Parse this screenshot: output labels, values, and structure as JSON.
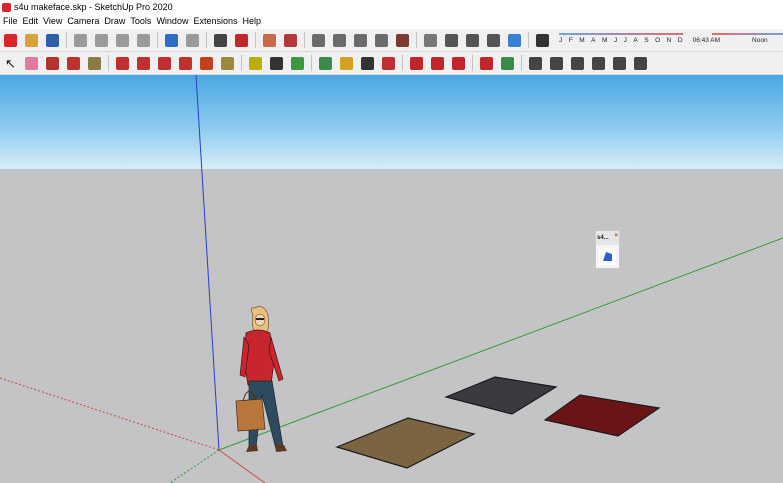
{
  "window": {
    "title": "s4u makeface.skp - SketchUp Pro 2020"
  },
  "menu": [
    {
      "label": "File"
    },
    {
      "label": "Edit"
    },
    {
      "label": "View"
    },
    {
      "label": "Camera"
    },
    {
      "label": "Draw"
    },
    {
      "label": "Tools"
    },
    {
      "label": "Window"
    },
    {
      "label": "Extensions"
    },
    {
      "label": "Help"
    }
  ],
  "shadow_settings": {
    "months": [
      "J",
      "F",
      "M",
      "A",
      "M",
      "J",
      "J",
      "A",
      "S",
      "O",
      "N",
      "D"
    ],
    "time": "06:43 AM",
    "noon": "Noon"
  },
  "toolbar_top": [
    {
      "name": "get-models-icon",
      "color": "#d9262a"
    },
    {
      "name": "open-icon",
      "color": "#d6a23a"
    },
    {
      "name": "save-icon",
      "color": "#2f5fa6"
    },
    {
      "name": "sep"
    },
    {
      "name": "cut-icon",
      "color": "#9a9a9a"
    },
    {
      "name": "copy-icon",
      "color": "#9a9a9a"
    },
    {
      "name": "paste-icon",
      "color": "#9a9a9a"
    },
    {
      "name": "erase-icon",
      "color": "#9a9a9a"
    },
    {
      "name": "sep"
    },
    {
      "name": "undo-icon",
      "color": "#2f6cc4"
    },
    {
      "name": "redo-icon",
      "color": "#9a9a9a"
    },
    {
      "name": "sep"
    },
    {
      "name": "print-icon",
      "color": "#444444"
    },
    {
      "name": "model-info-icon",
      "color": "#c0262a"
    },
    {
      "name": "sep"
    },
    {
      "name": "extension-warehouse-icon",
      "color": "#c86a4a"
    },
    {
      "name": "extension-manager-icon",
      "color": "#b33a3a"
    },
    {
      "name": "sep"
    },
    {
      "name": "style-1-icon",
      "color": "#6b6b6b"
    },
    {
      "name": "style-2-icon",
      "color": "#6b6b6b"
    },
    {
      "name": "style-3-icon",
      "color": "#6b6b6b"
    },
    {
      "name": "style-4-icon",
      "color": "#6b6b6b"
    },
    {
      "name": "style-5-icon",
      "color": "#7a3b30"
    },
    {
      "name": "sep"
    },
    {
      "name": "geo-location-icon",
      "color": "#777777"
    },
    {
      "name": "add-location-icon",
      "color": "#555555"
    },
    {
      "name": "cloud-upload-icon",
      "color": "#555555"
    },
    {
      "name": "share-icon",
      "color": "#555555"
    },
    {
      "name": "trimble-connect-icon",
      "color": "#3a7fd0"
    },
    {
      "name": "sep"
    },
    {
      "name": "shadows-toggle-icon",
      "color": "#333333"
    }
  ],
  "toolbar_bottom": [
    {
      "name": "select-icon",
      "color": "#111111"
    },
    {
      "name": "eraser-icon",
      "color": "#e07aa0"
    },
    {
      "name": "pencil-line-icon",
      "color": "#b3342c"
    },
    {
      "name": "arc-icon",
      "color": "#c03030"
    },
    {
      "name": "rectangle-icon",
      "color": "#8a7a4a"
    },
    {
      "name": "sep"
    },
    {
      "name": "push-pull-icon",
      "color": "#c03030"
    },
    {
      "name": "follow-me-icon",
      "color": "#c03030"
    },
    {
      "name": "move-icon",
      "color": "#c03030"
    },
    {
      "name": "rotate-icon",
      "color": "#c03030"
    },
    {
      "name": "scale-icon",
      "color": "#c04020"
    },
    {
      "name": "offset-icon",
      "color": "#9a8a3a"
    },
    {
      "name": "sep"
    },
    {
      "name": "tape-measure-icon",
      "color": "#b8b000"
    },
    {
      "name": "text-icon",
      "color": "#333333"
    },
    {
      "name": "paint-bucket-icon",
      "color": "#3a9a3a"
    },
    {
      "name": "sep"
    },
    {
      "name": "orbit-icon",
      "color": "#3a8a4a"
    },
    {
      "name": "pan-icon",
      "color": "#d4a020"
    },
    {
      "name": "zoom-icon",
      "color": "#333333"
    },
    {
      "name": "zoom-extents-icon",
      "color": "#c03030"
    },
    {
      "name": "sep"
    },
    {
      "name": "warehouse-icon",
      "color": "#c0262a"
    },
    {
      "name": "extension-1-icon",
      "color": "#c0262a"
    },
    {
      "name": "send-to-layout-icon",
      "color": "#c0262a"
    },
    {
      "name": "sep"
    },
    {
      "name": "extension-2-icon",
      "color": "#c0262a"
    },
    {
      "name": "user-profile-icon",
      "color": "#3a8a4a"
    },
    {
      "name": "sep"
    },
    {
      "name": "iso-view-icon",
      "color": "#444444"
    },
    {
      "name": "top-view-icon",
      "color": "#444444"
    },
    {
      "name": "front-view-icon",
      "color": "#444444"
    },
    {
      "name": "right-view-icon",
      "color": "#444444"
    },
    {
      "name": "back-view-icon",
      "color": "#444444"
    },
    {
      "name": "left-view-icon",
      "color": "#444444"
    }
  ],
  "viewport": {
    "sky_color": "#4aa8e3",
    "ground_color": "#c4c4c6",
    "axis_colors": {
      "red": "#d24a4a",
      "green": "#2f9b2f",
      "blue": "#2b3dc8"
    },
    "faces": [
      {
        "name": "brown-face",
        "color": "#7a6442"
      },
      {
        "name": "dark-gray-face",
        "color": "#3a3a40"
      },
      {
        "name": "red-face",
        "color": "#6a1418"
      }
    ]
  },
  "floating_palette": {
    "title": "s4...",
    "close": "×"
  }
}
